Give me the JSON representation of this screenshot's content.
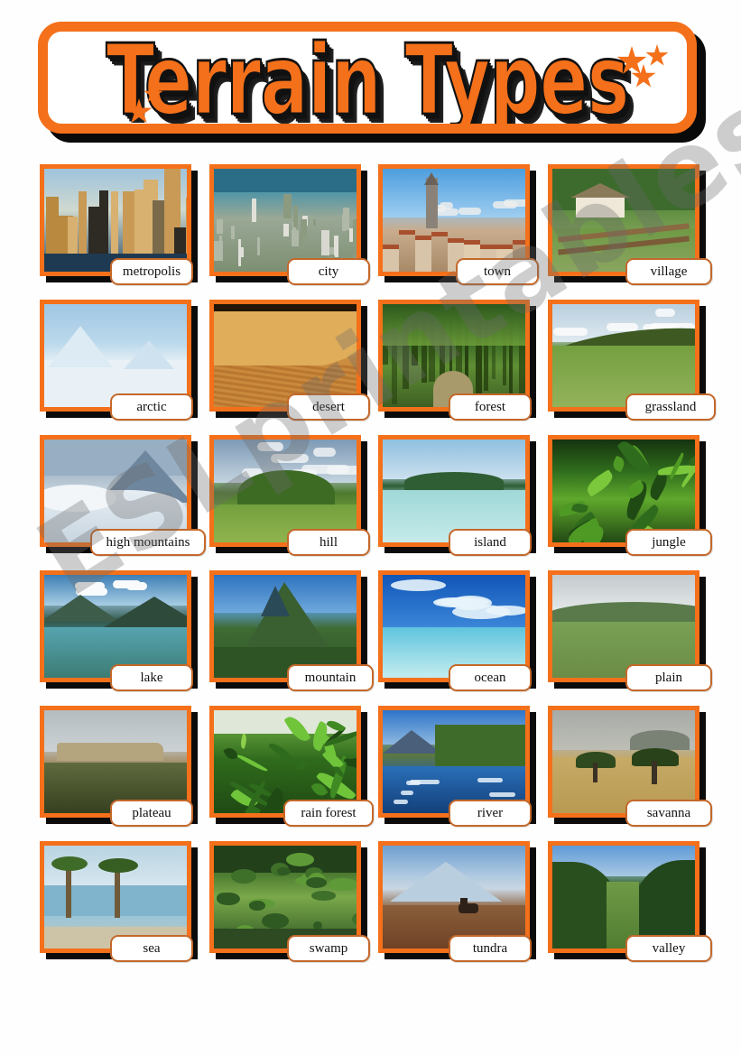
{
  "title": {
    "text": "Terrain Types",
    "accent_color": "#F4701A",
    "shadow_color": "#111111",
    "star_left_count": 2,
    "star_right_count": 3
  },
  "watermark": {
    "text": "ESLprintables.com",
    "color": "#696969"
  },
  "grid": {
    "columns": 4,
    "rows": 6,
    "rows_data": [
      [
        {
          "label": "metropolis",
          "scene": "metropolis",
          "label_offset": 78,
          "label_width": 90
        },
        {
          "label": "city",
          "scene": "city",
          "label_offset": 86,
          "label_width": 90
        },
        {
          "label": "town",
          "scene": "town",
          "label_offset": 86,
          "label_width": 90
        },
        {
          "label": "village",
          "scene": "village",
          "label_offset": 86,
          "label_width": 96
        }
      ],
      [
        {
          "label": "arctic",
          "scene": "arctic",
          "label_offset": 78,
          "label_width": 90
        },
        {
          "label": "desert",
          "scene": "desert",
          "label_offset": 86,
          "label_width": 90
        },
        {
          "label": "forest",
          "scene": "forest",
          "label_offset": 78,
          "label_width": 90
        },
        {
          "label": "grassland",
          "scene": "grassland",
          "label_offset": 86,
          "label_width": 100
        }
      ],
      [
        {
          "label": "high mountains",
          "scene": "highmtn",
          "label_offset": 56,
          "label_width": 128
        },
        {
          "label": "hill",
          "scene": "hill",
          "label_offset": 86,
          "label_width": 90
        },
        {
          "label": "island",
          "scene": "island",
          "label_offset": 78,
          "label_width": 90
        },
        {
          "label": "jungle",
          "scene": "jungle",
          "label_offset": 86,
          "label_width": 96
        }
      ],
      [
        {
          "label": "lake",
          "scene": "lake",
          "label_offset": 78,
          "label_width": 90
        },
        {
          "label": "mountain",
          "scene": "mountain",
          "label_offset": 86,
          "label_width": 96
        },
        {
          "label": "ocean",
          "scene": "ocean",
          "label_offset": 78,
          "label_width": 90
        },
        {
          "label": "plain",
          "scene": "plain",
          "label_offset": 86,
          "label_width": 96
        }
      ],
      [
        {
          "label": "plateau",
          "scene": "plateau",
          "label_offset": 78,
          "label_width": 90
        },
        {
          "label": "rain forest",
          "scene": "rainforest",
          "label_offset": 82,
          "label_width": 100
        },
        {
          "label": "river",
          "scene": "river",
          "label_offset": 78,
          "label_width": 90
        },
        {
          "label": "savanna",
          "scene": "savanna",
          "label_offset": 86,
          "label_width": 96
        }
      ],
      [
        {
          "label": "sea",
          "scene": "sea",
          "label_offset": 78,
          "label_width": 90
        },
        {
          "label": "swamp",
          "scene": "swamp",
          "label_offset": 86,
          "label_width": 90
        },
        {
          "label": "tundra",
          "scene": "tundra",
          "label_offset": 78,
          "label_width": 90
        },
        {
          "label": "valley",
          "scene": "valley",
          "label_offset": 86,
          "label_width": 96
        }
      ]
    ]
  },
  "style": {
    "card_border_color": "#F4701A",
    "card_shadow_color": "#0b0b0b",
    "chip_border_color": "#C4682A",
    "chip_background": "#ffffff"
  }
}
